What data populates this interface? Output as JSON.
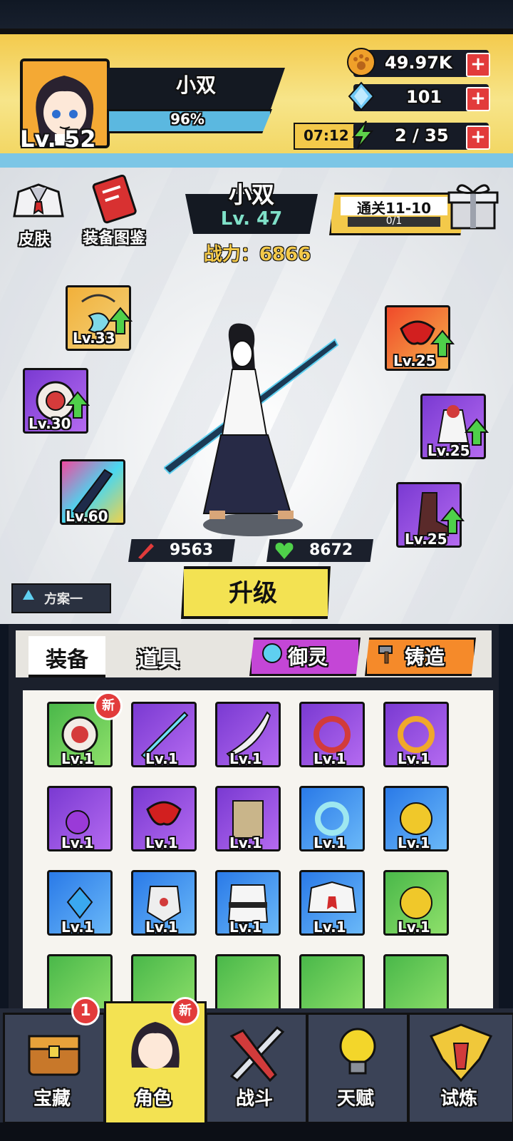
{
  "player": {
    "name": "小双",
    "exp_percent": "96%",
    "level": "Lv. 52"
  },
  "resources": {
    "coins": "49.97K",
    "gems": "101",
    "energy_timer": "07:12",
    "energy": "2 / 35",
    "plus": "+"
  },
  "character": {
    "name": "小双",
    "level": "Lv. 47",
    "power": "战力：6866",
    "attack": "9563",
    "hp": "8672"
  },
  "quest": {
    "title": "通关11-10",
    "progress": "0/1"
  },
  "left_menu": {
    "skin": "皮肤",
    "catalog": "装备图鉴"
  },
  "equipped": [
    {
      "lv": "Lv.33"
    },
    {
      "lv": "Lv.30"
    },
    {
      "lv": "Lv.60"
    },
    {
      "lv": "Lv.25"
    },
    {
      "lv": "Lv.25"
    },
    {
      "lv": "Lv.25"
    }
  ],
  "upgrade_button": "升级",
  "preset": "方案一",
  "tabs": {
    "equipment": "装备",
    "items": "道具",
    "spirit": "御灵",
    "forge": "铸造"
  },
  "inventory": [
    {
      "lv": "Lv.1",
      "badge": "新"
    },
    {
      "lv": "Lv.1"
    },
    {
      "lv": "Lv.1"
    },
    {
      "lv": "Lv.1"
    },
    {
      "lv": "Lv.1"
    },
    {
      "lv": "Lv.1"
    },
    {
      "lv": "Lv.1"
    },
    {
      "lv": "Lv.1"
    },
    {
      "lv": "Lv.1"
    },
    {
      "lv": "Lv.1"
    },
    {
      "lv": "Lv.1"
    },
    {
      "lv": "Lv.1"
    },
    {
      "lv": "Lv.1"
    },
    {
      "lv": "Lv.1"
    },
    {
      "lv": "Lv.1"
    }
  ],
  "nav": {
    "treasure": "宝藏",
    "treasure_badge": "1",
    "role": "角色",
    "role_badge": "新",
    "battle": "战斗",
    "talent": "天赋",
    "trial": "试炼"
  }
}
